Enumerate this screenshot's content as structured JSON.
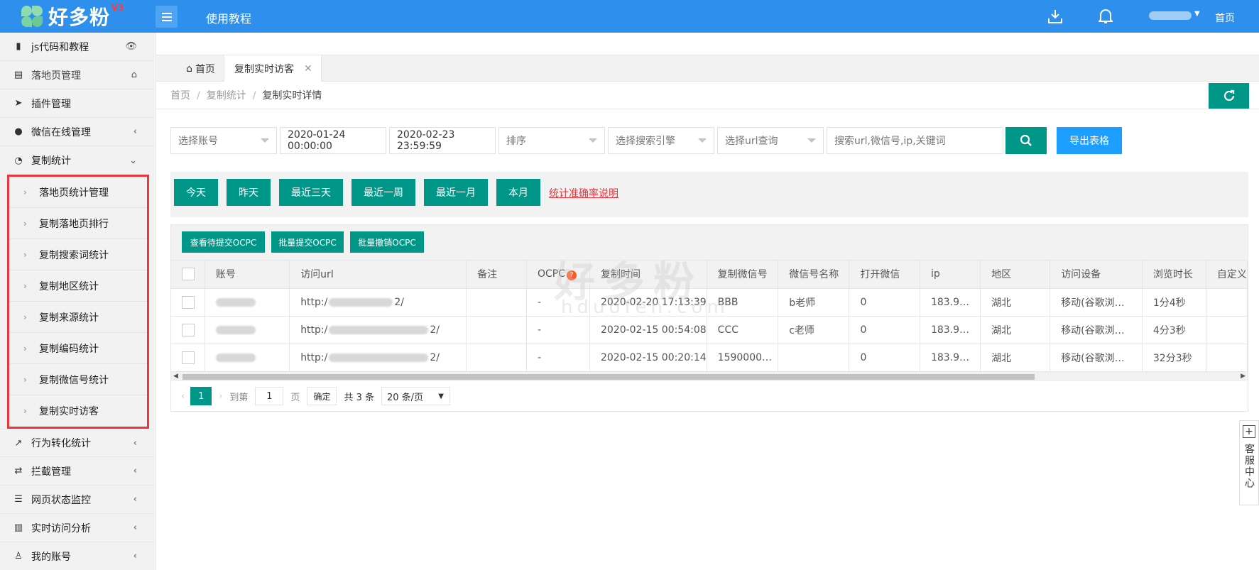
{
  "header": {
    "logo_text": "好多粉",
    "logo_version": "V3",
    "tutorial": "使用教程",
    "home": "首页"
  },
  "sidebar": {
    "items_top": [
      {
        "label": "js代码和教程",
        "icon": "bookmark-icon",
        "right": "👁"
      },
      {
        "label": "落地页管理",
        "icon": "page-icon",
        "right": "⌂"
      },
      {
        "label": "插件管理",
        "icon": "send-icon",
        "right": ""
      },
      {
        "label": "微信在线管理",
        "icon": "wechat-icon",
        "right": "‹"
      },
      {
        "label": "复制统计",
        "icon": "pie-icon",
        "right": "⌄"
      }
    ],
    "sub_items": [
      "落地页统计管理",
      "复制落地页排行",
      "复制搜索词统计",
      "复制地区统计",
      "复制来源统计",
      "复制编码统计",
      "复制微信号统计",
      "复制实时访客"
    ],
    "items_bottom": [
      {
        "label": "行为转化统计",
        "icon": "line-chart-icon",
        "right": "‹"
      },
      {
        "label": "拦截管理",
        "icon": "exchange-icon",
        "right": "‹"
      },
      {
        "label": "网页状态监控",
        "icon": "server-icon",
        "right": "‹"
      },
      {
        "label": "实时访问分析",
        "icon": "bar-chart-icon",
        "right": "‹"
      },
      {
        "label": "我的账号",
        "icon": "user-icon",
        "right": "‹"
      }
    ]
  },
  "tabs": [
    {
      "label": "首页"
    },
    {
      "label": "复制实时访客"
    }
  ],
  "breadcrumb": [
    "首页",
    "复制统计",
    "复制实时详情"
  ],
  "filters": {
    "account_placeholder": "选择账号",
    "start_date": "2020-01-24 00:00:00",
    "end_date": "2020-02-23 23:59:59",
    "sort_placeholder": "排序",
    "engine_placeholder": "选择搜索引擎",
    "url_placeholder": "选择url查询",
    "search_placeholder": "搜索url,微信号,ip,关键词",
    "export_label": "导出表格"
  },
  "quick": {
    "buttons": [
      "今天",
      "昨天",
      "最近三天",
      "最近一周",
      "最近一月",
      "本月"
    ],
    "link": "统计准确率说明"
  },
  "toolbar": {
    "buttons": [
      "查看待提交OCPC",
      "批量提交OCPC",
      "批量撤销OCPC"
    ]
  },
  "table": {
    "columns": [
      "账号",
      "访问url",
      "备注",
      "OCPC",
      "复制时间",
      "复制微信号",
      "微信号名称",
      "打开微信",
      "ip",
      "地区",
      "访问设备",
      "浏览时长",
      "自定义"
    ],
    "rows": [
      {
        "url_prefix": "http:/",
        "url_suffix": "2/",
        "ocpc": "-",
        "time": "2020-02-20 17:13:39",
        "wechat": "BBB",
        "name": "b老师",
        "open": "0",
        "ip": "183.9…",
        "region": "湖北",
        "device": "移动(谷歌浏…",
        "duration": "1分4秒"
      },
      {
        "url_prefix": "http:/",
        "url_suffix": "2/",
        "ocpc": "-",
        "time": "2020-02-15 00:54:08",
        "wechat": "CCC",
        "name": "c老师",
        "open": "0",
        "ip": "183.9…",
        "region": "湖北",
        "device": "移动(谷歌浏…",
        "duration": "4分3秒"
      },
      {
        "url_prefix": "http:/",
        "url_suffix": "2/",
        "ocpc": "-",
        "time": "2020-02-15 00:20:14",
        "wechat": "1590000…",
        "name": "",
        "open": "0",
        "ip": "183.9…",
        "region": "湖北",
        "device": "移动(谷歌浏…",
        "duration": "32分3秒"
      }
    ]
  },
  "pager": {
    "current": "1",
    "goto": "到第",
    "page_value": "1",
    "page_unit": "页",
    "confirm": "确定",
    "total": "共 3 条",
    "per_page": "20 条/页"
  },
  "watermark": {
    "main": "好多粉",
    "sub": "hduofen.com"
  },
  "service": {
    "label": "客服中心"
  }
}
